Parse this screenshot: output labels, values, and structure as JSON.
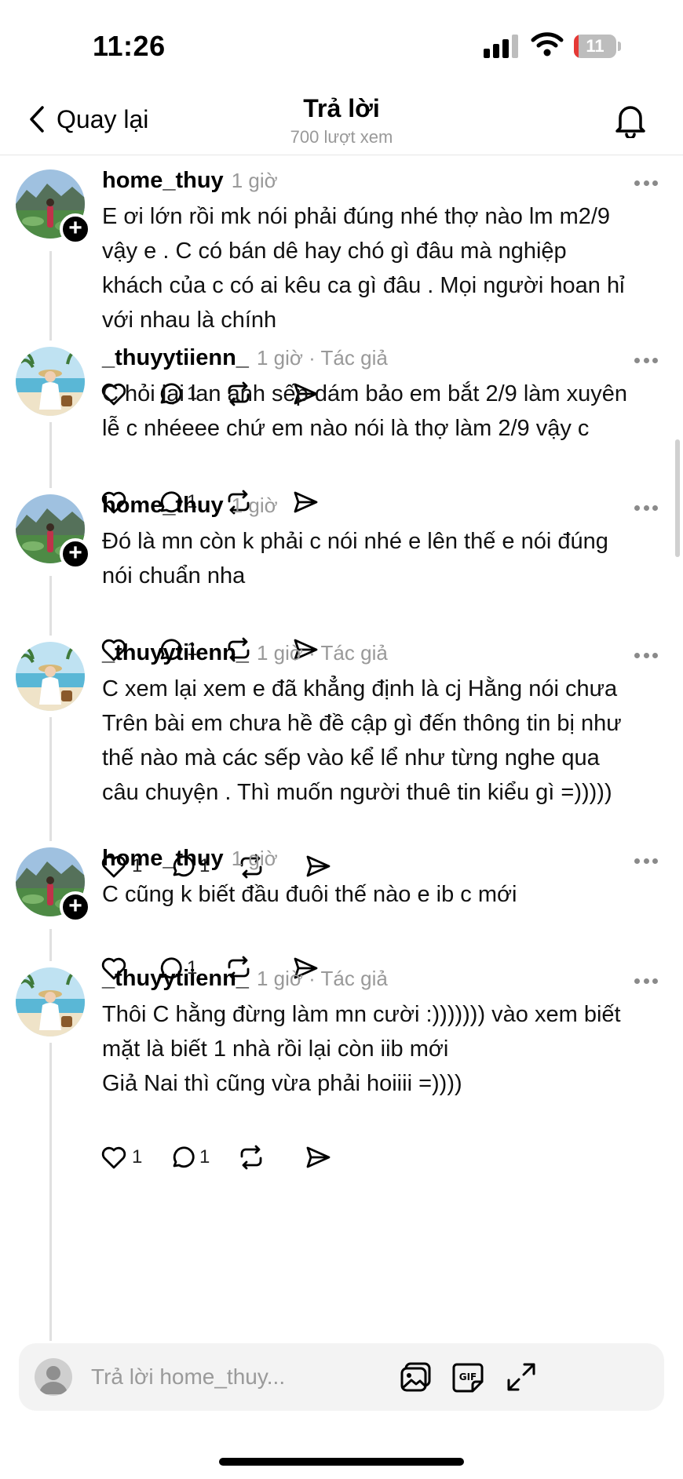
{
  "status": {
    "time": "11:26",
    "battery": "11",
    "battery_level": 0.11
  },
  "nav": {
    "back_label": "Quay lại",
    "title": "Trả lời",
    "views": "700 lượt xem"
  },
  "posts": [
    {
      "username": "home_thuy",
      "meta": "1 giờ",
      "avatar": "landscape",
      "follow": true,
      "lines": [
        "E ơi lớn rồi mk nói phải đúng nhé thợ nào lm m2/9",
        "vậy e . C có bán dê hay chó gì đâu mà nghiệp",
        "khách của c có ai kêu ca gì đâu . Mọi người hoan hỉ",
        "với nhau là chính"
      ],
      "likes": "",
      "replies": "1"
    },
    {
      "username": "_thuyytiienn_",
      "meta": "1 giờ · Tác giả",
      "avatar": "beach",
      "follow": false,
      "lines": [
        "C hỏi lại lan anh sếp dám bảo em bắt 2/9 làm xuyên",
        "lễ c nhéeee chứ em nào nói là thợ làm 2/9 vậy c"
      ],
      "likes": "",
      "replies": "1"
    },
    {
      "username": "home_thuy",
      "meta": "1 giờ",
      "avatar": "landscape",
      "follow": true,
      "lines": [
        "Đó là mn còn k phải c nói nhé e lên thế e nói đúng",
        "nói chuẩn nha"
      ],
      "likes": "",
      "replies": "1"
    },
    {
      "username": "_thuyytiienn_",
      "meta": "1 giờ · Tác giả",
      "avatar": "beach",
      "follow": false,
      "lines": [
        "C xem lại xem e đã khẳng định là cj Hằng nói chưa",
        "Trên bài em chưa hề đề cập gì đến thông tin bị như",
        "thế nào mà các sếp vào kể lể như từng nghe qua",
        "câu chuyện . Thì muốn người thuê tin kiểu gì =)))))"
      ],
      "likes": "1",
      "replies": "1"
    },
    {
      "username": "home_thuy",
      "meta": "1 giờ",
      "avatar": "landscape",
      "follow": true,
      "lines": [
        "C cũng k biết đầu đuôi thế nào e ib c mới"
      ],
      "likes": "",
      "replies": "1"
    },
    {
      "username": "_thuyytiienn_",
      "meta": "1 giờ · Tác giả",
      "avatar": "beach",
      "follow": false,
      "lines": [
        "Thôi C hằng đừng làm mn cười :))))))) vào xem biết",
        "mặt là biết 1 nhà rồi lại còn iib mới",
        "Giả Nai thì cũng vừa phải hoiiii =))))"
      ],
      "likes": "1",
      "replies": "1"
    }
  ],
  "composer": {
    "placeholder": "Trả lời home_thuy...",
    "value": ""
  },
  "icons": {
    "back": "chevron-left-icon",
    "bell": "bell-icon",
    "like": "heart-icon",
    "reply": "comment-icon",
    "repost": "repost-icon",
    "share": "send-icon",
    "more": "more-horizontal-icon",
    "gallery": "image-icon",
    "gif": "gif-icon",
    "expand": "expand-icon"
  }
}
